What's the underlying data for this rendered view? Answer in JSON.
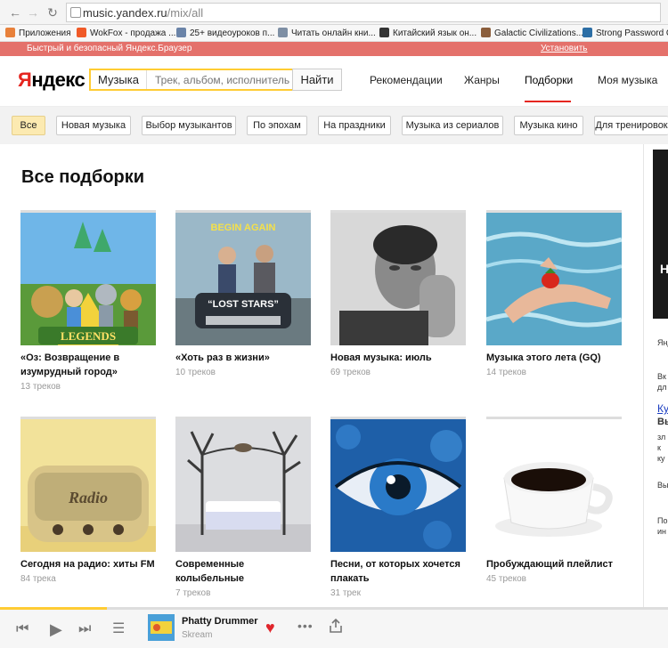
{
  "browser": {
    "url_host": "music.yandex.ru",
    "url_path": "/mix/all",
    "bookmarks": [
      {
        "label": "Приложения",
        "color": "#e8813b"
      },
      {
        "label": "WokFox - продажа ...",
        "color": "#f05a28"
      },
      {
        "label": "25+ видеоуроков п...",
        "color": "#6b84a8"
      },
      {
        "label": "Читать онлайн кни...",
        "color": "#7e8fa4"
      },
      {
        "label": "Китайский язык он...",
        "color": "#333333"
      },
      {
        "label": "Galactic Civilizations...",
        "color": "#8b5e3c"
      },
      {
        "label": "Strong Password Ge",
        "color": "#2c6ea5"
      }
    ],
    "notice_text": "Быстрый и безопасный Яндекс.Браузер",
    "notice_action": "Установить"
  },
  "header": {
    "logo_first": "Я",
    "logo_rest": "ндекс",
    "search_tag": "Музыка",
    "search_placeholder": "Трек, альбом, исполнитель",
    "search_button": "Найти",
    "nav": [
      "Рекомендации",
      "Жанры",
      "Подборки",
      "Моя музыка"
    ],
    "active_nav": "Подборки"
  },
  "filters": [
    "Все",
    "Новая музыка",
    "Выбор музыкантов",
    "По эпохам",
    "На праздники",
    "Музыка из сериалов",
    "Музыка кино",
    "Для тренировок"
  ],
  "active_filter": "Все",
  "page_title": "Все подборки",
  "cards": [
    {
      "title": "«Оз: Возвращение в изумрудный город»",
      "count": "13 треков",
      "cover": "oz-cover"
    },
    {
      "title": "«Хоть раз в жизни»",
      "count": "10 треков",
      "cover": "begin-again-cover"
    },
    {
      "title": "Новая музыка: июль",
      "count": "69 треков",
      "cover": "portrait-cover"
    },
    {
      "title": "Музыка этого лета (GQ)",
      "count": "14 треков",
      "cover": "summer-water-cover"
    },
    {
      "title": "Сегодня на радио: хиты FM",
      "count": "84 трека",
      "cover": "radio-cover"
    },
    {
      "title": "Современные колыбельные",
      "count": "7 треков",
      "cover": "bed-cover"
    },
    {
      "title": "Песни, от которых хочется плакать",
      "count": "31 трек",
      "cover": "eye-cover"
    },
    {
      "title": "Пробуждающий плейлист",
      "count": "45 треков",
      "cover": "coffee-cover"
    }
  ],
  "cover_text": {
    "oz_logo": "LEGENDS",
    "begin_again": "BEGIN AGAIN",
    "lost_stars": "“LOST STARS”",
    "radio": "Radio"
  },
  "sidebar_peek": {
    "banner_letter": "Н",
    "lines": [
      "Янд",
      "Вк",
      "дл",
      "Ку",
      "Вы",
      "зл",
      "к",
      "ку",
      "Вы",
      "По",
      "ин"
    ]
  },
  "player": {
    "title": "Phatty Drummer",
    "artist": "Skream",
    "progress": 0.16,
    "colors": {
      "accent": "#ffcc33",
      "like": "#e0262c"
    }
  }
}
